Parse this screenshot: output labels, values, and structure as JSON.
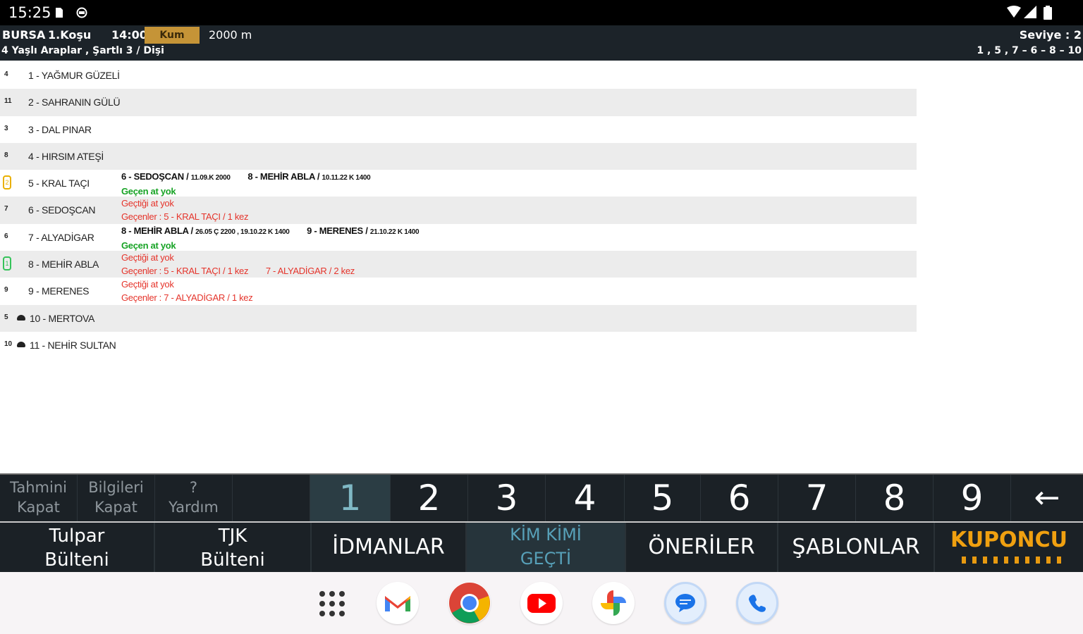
{
  "status_bar": {
    "time": "15:25"
  },
  "race_header": {
    "track": "BURSA",
    "race": "1.Koşu",
    "time": "14:00",
    "surface": "Kum",
    "distance": "2000 m",
    "conditions": "4 Yaşlı Araplar , Şartlı 3 / Dişi",
    "level": "Seviye : 2",
    "order": "1 , 5 , 7 – 6 – 8 – 10"
  },
  "horses": [
    {
      "num": "4",
      "name": "1 - YAĞMUR GÜZELİ"
    },
    {
      "num": "11",
      "name": "2 - SAHRANIN GÜLÜ"
    },
    {
      "num": "3",
      "name": "3 - DAL PINAR"
    },
    {
      "num": "8",
      "name": "4 - HIRSIM ATEŞİ"
    },
    {
      "num": "2",
      "name": "5 - KRAL TAÇI"
    },
    {
      "num": "7",
      "name": "6 - SEDOŞCAN"
    },
    {
      "num": "6",
      "name": "7 - ALYADİGAR"
    },
    {
      "num": "1",
      "name": "8 - MEHİR ABLA"
    },
    {
      "num": "9",
      "name": "9 - MERENES"
    },
    {
      "num": "5",
      "name": "10 - MERTOVA"
    },
    {
      "num": "10",
      "name": "11 - NEHİR SULTAN"
    }
  ],
  "notes": {
    "kral_taci": {
      "beat1": "6 - SEDOŞCAN /",
      "beat1_detail": "11.09.K 2000",
      "beat2": "8 - MEHİR ABLA /",
      "beat2_detail": "10.11.22 K 1400",
      "gecen": "Geçen at yok"
    },
    "sedoscan": {
      "gectigi": "Geçtiği at yok",
      "gecenler": "Geçenler : 5 - KRAL TAÇI / 1 kez"
    },
    "alyadigar": {
      "beat1": "8 - MEHİR ABLA /",
      "beat1_detail": "26.05 Ç 2200 , 19.10.22 K 1400",
      "beat2": "9 - MERENES /",
      "beat2_detail": "21.10.22 K 1400",
      "gecen": "Geçen at yok"
    },
    "mehir_abla": {
      "gectigi": "Geçtiği at yok",
      "gecenler": "Geçenler : 5 - KRAL TAÇI / 1 kez",
      "gecenler2": "7 - ALYADİGAR / 2 kez"
    },
    "merenes": {
      "gectigi": "Geçtiği at yok",
      "gecenler": "Geçenler : 7 - ALYADİGAR / 1 kez"
    }
  },
  "numpad": {
    "tahmini": [
      "Tahmini",
      "Kapat"
    ],
    "bilgileri": [
      "Bilgileri",
      "Kapat"
    ],
    "yardim": [
      "?",
      "Yardım"
    ],
    "digits": [
      "1",
      "2",
      "3",
      "4",
      "5",
      "6",
      "7",
      "8",
      "9"
    ],
    "back": "←"
  },
  "tabs": {
    "tulpar": [
      "Tulpar",
      "Bülteni"
    ],
    "tjk": [
      "TJK",
      "Bülteni"
    ],
    "idmanlar": "İDMANLAR",
    "kimkimi": [
      "KİM KİMİ",
      "GEÇTİ"
    ],
    "oneriler": "ÖNERİLER",
    "sablonlar": "ŞABLONLAR",
    "kuponcu": "KUPONCU"
  },
  "dock": [
    "apps-icon",
    "gmail-icon",
    "chrome-icon",
    "youtube-icon",
    "photos-icon",
    "messages-icon",
    "phone-icon"
  ]
}
